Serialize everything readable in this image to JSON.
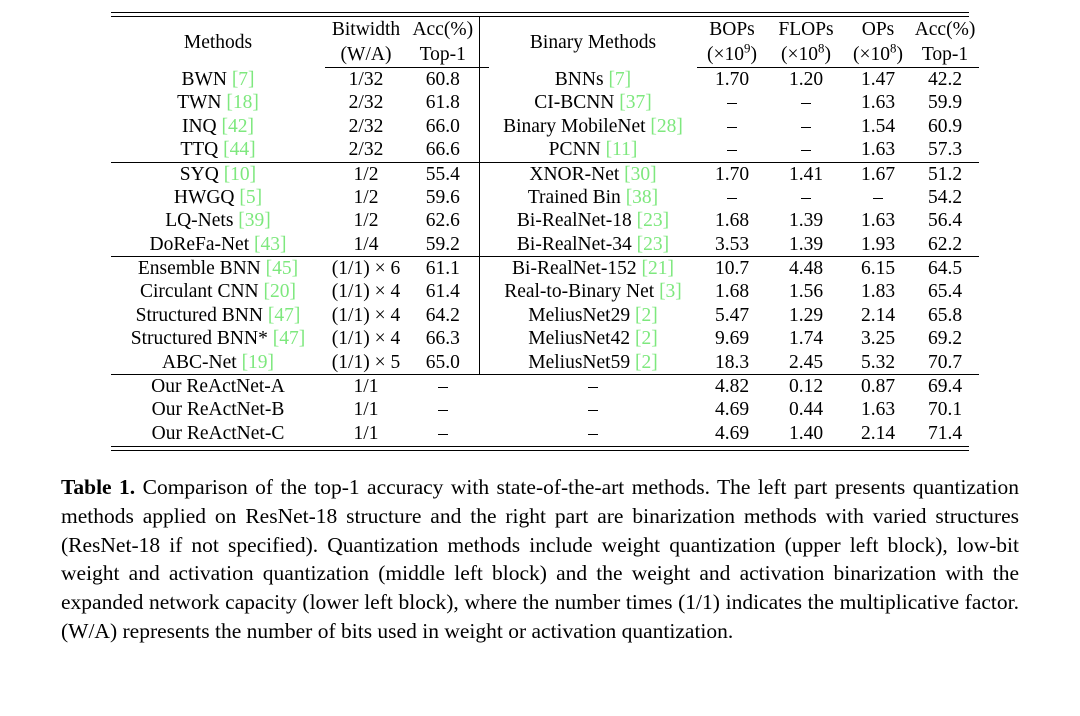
{
  "table": {
    "left_header": {
      "methods": "Methods",
      "bitwidth_top": "Bitwidth",
      "bitwidth_bot": "(W/A)",
      "acc_top": "Acc(%)",
      "acc_bot": "Top-1"
    },
    "right_header": {
      "methods": "Binary Methods",
      "bops_top": "BOPs",
      "bops_bot_pre": "(×10",
      "bops_bot_sup": "9",
      "bops_bot_post": ")",
      "flops_top": "FLOPs",
      "flops_bot_pre": "(×10",
      "flops_bot_sup": "8",
      "flops_bot_post": ")",
      "ops_top": "OPs",
      "ops_bot_pre": "(×10",
      "ops_bot_sup": "8",
      "ops_bot_post": ")",
      "acc_top": "Acc(%)",
      "acc_bot": "Top-1"
    },
    "left_blocks": [
      [
        {
          "name": "BWN",
          "cite": "[7]",
          "bitwidth": "1/32",
          "acc": "60.8"
        },
        {
          "name": "TWN",
          "cite": "[18]",
          "bitwidth": "2/32",
          "acc": "61.8"
        },
        {
          "name": "INQ",
          "cite": "[42]",
          "bitwidth": "2/32",
          "acc": "66.0"
        },
        {
          "name": "TTQ",
          "cite": "[44]",
          "bitwidth": "2/32",
          "acc": "66.6"
        }
      ],
      [
        {
          "name": "SYQ",
          "cite": "[10]",
          "bitwidth": "1/2",
          "acc": "55.4"
        },
        {
          "name": "HWGQ",
          "cite": "[5]",
          "bitwidth": "1/2",
          "acc": "59.6"
        },
        {
          "name": "LQ-Nets",
          "cite": "[39]",
          "bitwidth": "1/2",
          "acc": "62.6"
        },
        {
          "name": "DoReFa-Net",
          "cite": "[43]",
          "bitwidth": "1/4",
          "acc": "59.2"
        }
      ],
      [
        {
          "name": "Ensemble BNN",
          "cite": "[45]",
          "bitwidth": "(1/1) × 6",
          "acc": "61.1"
        },
        {
          "name": "Circulant CNN",
          "cite": "[20]",
          "bitwidth": "(1/1) × 4",
          "acc": "61.4"
        },
        {
          "name": "Structured BNN",
          "cite": "[47]",
          "bitwidth": "(1/1) × 4",
          "acc": "64.2"
        },
        {
          "name": "Structured BNN*",
          "cite": "[47]",
          "bitwidth": "(1/1) × 4",
          "acc": "66.3"
        },
        {
          "name": "ABC-Net",
          "cite": "[19]",
          "bitwidth": "(1/1) × 5",
          "acc": "65.0"
        }
      ]
    ],
    "right_blocks": [
      [
        {
          "name": "BNNs",
          "cite": "[7]",
          "bops": "1.70",
          "flops": "1.20",
          "ops": "1.47",
          "acc": "42.2"
        },
        {
          "name": "CI-BCNN",
          "cite": "[37]",
          "bops": "–",
          "flops": "–",
          "ops": "1.63",
          "acc": "59.9"
        },
        {
          "name": "Binary MobileNet",
          "cite": "[28]",
          "bops": "–",
          "flops": "–",
          "ops": "1.54",
          "acc": "60.9"
        },
        {
          "name": "PCNN",
          "cite": "[11]",
          "bops": "–",
          "flops": "–",
          "ops": "1.63",
          "acc": "57.3"
        }
      ],
      [
        {
          "name": "XNOR-Net",
          "cite": "[30]",
          "bops": "1.70",
          "flops": "1.41",
          "ops": "1.67",
          "acc": "51.2"
        },
        {
          "name": "Trained Bin",
          "cite": "[38]",
          "bops": "–",
          "flops": "–",
          "ops": "–",
          "acc": "54.2"
        },
        {
          "name": "Bi-RealNet-18",
          "cite": "[23]",
          "bops": "1.68",
          "flops": "1.39",
          "ops": "1.63",
          "acc": "56.4"
        },
        {
          "name": "Bi-RealNet-34",
          "cite": "[23]",
          "bops": "3.53",
          "flops": "1.39",
          "ops": "1.93",
          "acc": "62.2"
        }
      ],
      [
        {
          "name": "Bi-RealNet-152",
          "cite": "[21]",
          "bops": "10.7",
          "flops": "4.48",
          "ops": "6.15",
          "acc": "64.5"
        },
        {
          "name": "Real-to-Binary Net",
          "cite": "[3]",
          "bops": "1.68",
          "flops": "1.56",
          "ops": "1.83",
          "acc": "65.4"
        },
        {
          "name": "MeliusNet29",
          "cite": "[2]",
          "bops": "5.47",
          "flops": "1.29",
          "ops": "2.14",
          "acc": "65.8"
        },
        {
          "name": "MeliusNet42",
          "cite": "[2]",
          "bops": "9.69",
          "flops": "1.74",
          "ops": "3.25",
          "acc": "69.2"
        },
        {
          "name": "MeliusNet59",
          "cite": "[2]",
          "bops": "18.3",
          "flops": "2.45",
          "ops": "5.32",
          "acc": "70.7"
        }
      ]
    ],
    "our_rows": [
      {
        "name": "Our ReActNet-A",
        "bitwidth": "1/1",
        "acc": "–",
        "rmethod": "–",
        "bops": "4.82",
        "flops": "0.12",
        "ops": "0.87",
        "racc": "69.4"
      },
      {
        "name": "Our ReActNet-B",
        "bitwidth": "1/1",
        "acc": "–",
        "rmethod": "–",
        "bops": "4.69",
        "flops": "0.44",
        "ops": "1.63",
        "racc": "70.1"
      },
      {
        "name": "Our ReActNet-C",
        "bitwidth": "1/1",
        "acc": "–",
        "rmethod": "–",
        "bops": "4.69",
        "flops": "1.40",
        "ops": "2.14",
        "racc": "71.4"
      }
    ]
  },
  "caption": {
    "label": "Table 1.",
    "text": " Comparison of the top-1 accuracy with state-of-the-art methods. The left part presents quantization methods applied on ResNet-18 structure and the right part are binarization methods with varied structures (ResNet-18 if not specified). Quantization methods include weight quantization (upper left block), low-bit weight and activation quantization (middle left block) and the weight and activation binarization with the expanded network capacity (lower left block), where the number times (1/1) indicates the multiplicative factor. (W/A) represents the number of bits used in weight or activation quantization."
  },
  "colors": {
    "citation_green": "#7ee87e",
    "rule_black": "#000000",
    "page_background": "#ffffff"
  }
}
